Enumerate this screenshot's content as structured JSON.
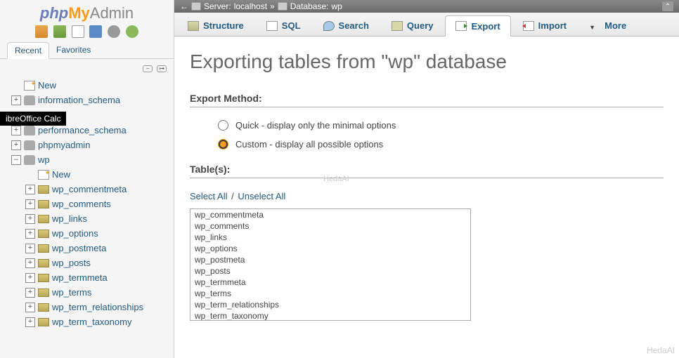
{
  "logo": {
    "php": "php",
    "my": "My",
    "admin": "Admin"
  },
  "sidebar_tabs": {
    "recent": "Recent",
    "favorites": "Favorites"
  },
  "tooltip": "ibreOffice Calc",
  "tree": {
    "new": "New",
    "dbs": [
      {
        "name": "information_schema",
        "expanded": false
      },
      {
        "name": "performance_schema",
        "expanded": false
      },
      {
        "name": "phpmyadmin",
        "expanded": false
      },
      {
        "name": "wp",
        "expanded": true
      }
    ],
    "wp_new": "New",
    "wp_tables": [
      "wp_commentmeta",
      "wp_comments",
      "wp_links",
      "wp_options",
      "wp_postmeta",
      "wp_posts",
      "wp_termmeta",
      "wp_terms",
      "wp_term_relationships",
      "wp_term_taxonomy"
    ]
  },
  "breadcrumb": {
    "server_label": "Server:",
    "server_value": "localhost",
    "sep": "»",
    "db_label": "Database:",
    "db_value": "wp"
  },
  "main_tabs": [
    {
      "key": "structure",
      "label": "Structure",
      "icon": "ti-struct"
    },
    {
      "key": "sql",
      "label": "SQL",
      "icon": "ti-sql"
    },
    {
      "key": "search",
      "label": "Search",
      "icon": "ti-search"
    },
    {
      "key": "query",
      "label": "Query",
      "icon": "ti-query"
    },
    {
      "key": "export",
      "label": "Export",
      "icon": "ti-export",
      "active": true
    },
    {
      "key": "import",
      "label": "Import",
      "icon": "ti-import"
    },
    {
      "key": "more",
      "label": "More",
      "icon": "ti-more"
    }
  ],
  "page": {
    "title": "Exporting tables from \"wp\" database",
    "export_method_head": "Export Method:",
    "opt_quick": "Quick - display only the minimal options",
    "opt_custom": "Custom - display all possible options",
    "tables_head": "Table(s):",
    "select_all": "Select All",
    "unselect_all": "Unselect All",
    "sep": "/",
    "table_list": [
      "wp_commentmeta",
      "wp_comments",
      "wp_links",
      "wp_options",
      "wp_postmeta",
      "wp_posts",
      "wp_termmeta",
      "wp_terms",
      "wp_term_relationships",
      "wp_term_taxonomy"
    ]
  },
  "watermark": "HedaAI"
}
